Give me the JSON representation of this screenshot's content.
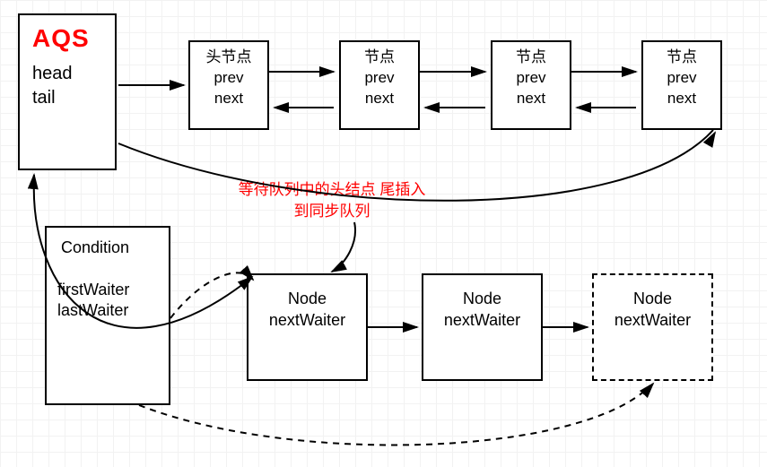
{
  "aqs": {
    "title": "AQS",
    "head_label": "head",
    "tail_label": "tail"
  },
  "sync_queue": [
    {
      "title": "头节点",
      "prev": "prev",
      "next": "next"
    },
    {
      "title": "节点",
      "prev": "prev",
      "next": "next"
    },
    {
      "title": "节点",
      "prev": "prev",
      "next": "next"
    },
    {
      "title": "节点",
      "prev": "prev",
      "next": "next"
    }
  ],
  "annotation": {
    "line1": "等待队列中的头结点",
    "line2": "尾插入到同步队列"
  },
  "condition": {
    "title": "Condition",
    "firstWaiter": "firstWaiter",
    "lastWaiter": "lastWaiter"
  },
  "wait_queue": [
    {
      "title": "Node",
      "next": "nextWaiter",
      "dashed": false
    },
    {
      "title": "Node",
      "next": "nextWaiter",
      "dashed": false
    },
    {
      "title": "Node",
      "next": "nextWaiter",
      "dashed": true
    }
  ]
}
